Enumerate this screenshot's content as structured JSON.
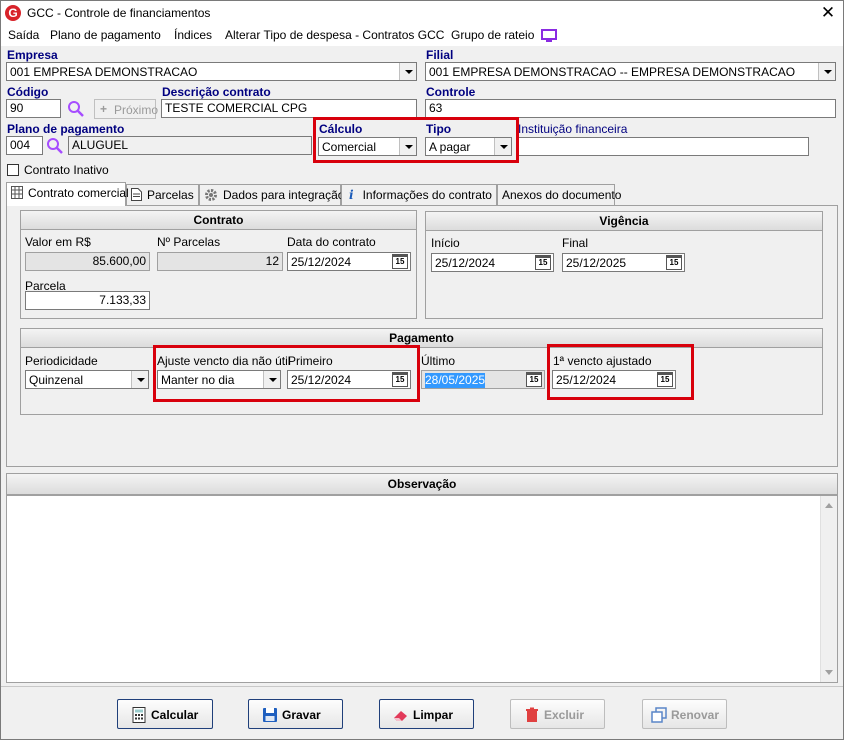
{
  "window": {
    "title": "GCC - Controle de financiamentos",
    "logo_letter": "G"
  },
  "menu": [
    "Saída",
    "Plano de pagamento",
    "Índices",
    "Alterar Tipo de despesa - Contratos GCC",
    "Grupo de rateio"
  ],
  "header": {
    "empresa_label": "Empresa",
    "empresa_value": "001 EMPRESA DEMONSTRACAO",
    "filial_label": "Filial",
    "filial_value": "001 EMPRESA DEMONSTRACAO -- EMPRESA DEMONSTRACAO",
    "codigo_label": "Código",
    "codigo_value": "90",
    "proximo_label": "Próximo",
    "descricao_label": "Descrição contrato",
    "descricao_value": "TESTE COMERCIAL CPG",
    "controle_label": "Controle",
    "controle_value": "63",
    "plano_label": "Plano de pagamento",
    "plano_code": "004",
    "plano_desc": "ALUGUEL",
    "calculo_label": "Cálculo",
    "calculo_value": "Comercial",
    "tipo_label": "Tipo",
    "tipo_value": "A pagar",
    "instituicao_label": "Instituição financeira",
    "instituicao_value": "",
    "inativo_label": "Contrato Inativo"
  },
  "tabs": [
    "Contrato comercial",
    "Parcelas",
    "Dados para integração",
    "Informações do contrato",
    "Anexos do documento"
  ],
  "contrato": {
    "title": "Contrato",
    "valor_label": "Valor em R$",
    "valor_value": "85.600,00",
    "nparcelas_label": "Nº Parcelas",
    "nparcelas_value": "12",
    "data_label": "Data do contrato",
    "data_value": "25/12/2024",
    "parcela_label": "Parcela",
    "parcela_value": "7.133,33"
  },
  "vigencia": {
    "title": "Vigência",
    "inicio_label": "Início",
    "inicio_value": "25/12/2024",
    "final_label": "Final",
    "final_value": "25/12/2025"
  },
  "pagamento": {
    "title": "Pagamento",
    "periodicidade_label": "Periodicidade",
    "periodicidade_value": "Quinzenal",
    "ajuste_label": "Ajuste vencto dia não útil",
    "ajuste_value": "Manter no dia",
    "primeiro_label": "Primeiro",
    "primeiro_value": "25/12/2024",
    "ultimo_label": "Último",
    "ultimo_value": "28/05/2025",
    "vencto_label": "1ª vencto ajustado",
    "vencto_value": "25/12/2024"
  },
  "observacao": {
    "title": "Observação",
    "value": ""
  },
  "buttons": {
    "calcular": "Calcular",
    "gravar": "Gravar",
    "limpar": "Limpar",
    "excluir": "Excluir",
    "renovar": "Renovar"
  },
  "calendar_glyph": "15",
  "colors": {
    "label_navy": "#000080",
    "highlight_red": "#d8000c",
    "logo_red": "#d8232a"
  }
}
